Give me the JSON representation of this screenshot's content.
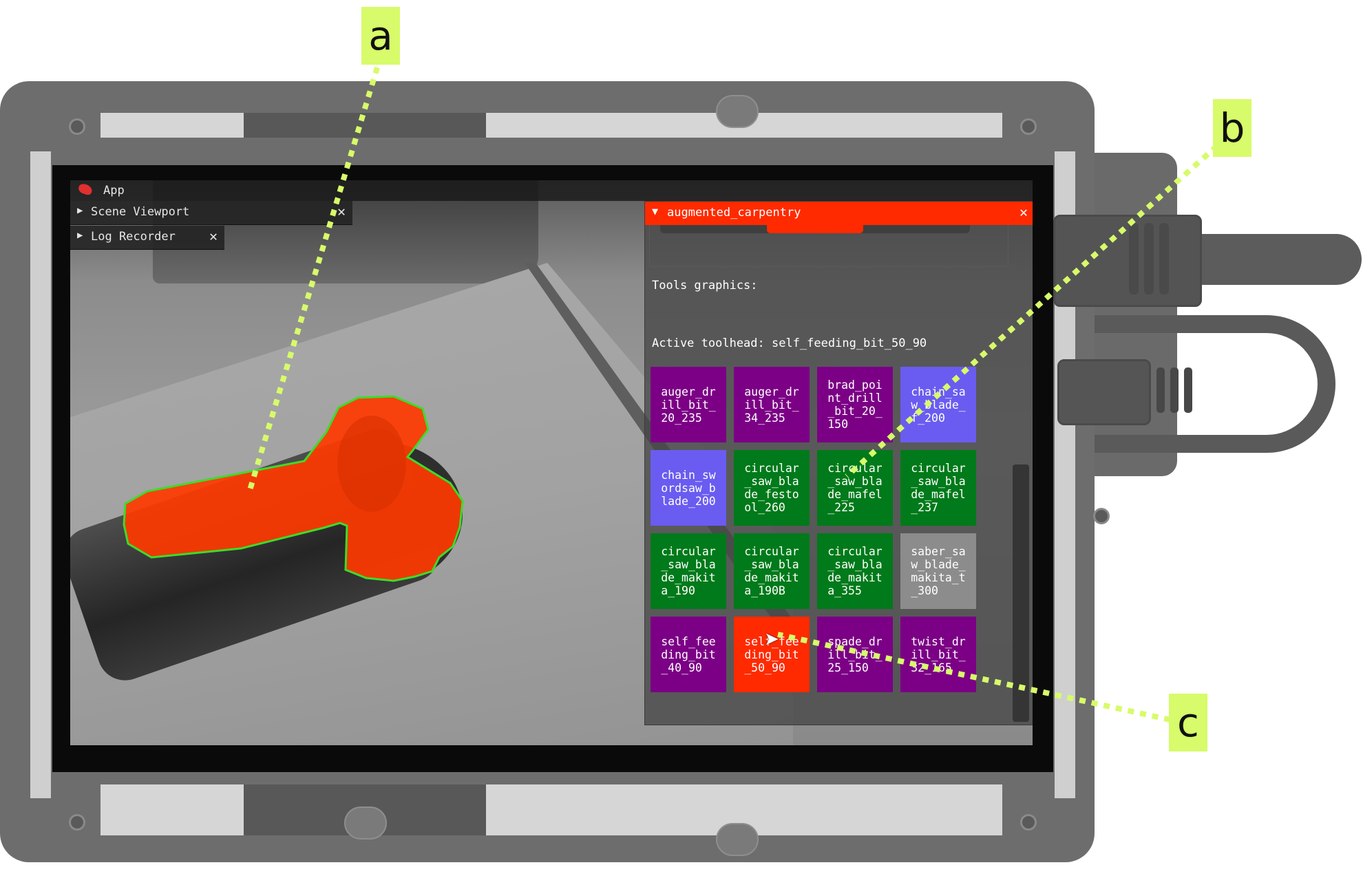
{
  "app": {
    "title": "App"
  },
  "windows": {
    "scene_viewport": {
      "title": "Scene Viewport",
      "expand_icon": "triangle-right",
      "close_label": "✕"
    },
    "log_recorder": {
      "title": "Log Recorder",
      "expand_icon": "triangle-right",
      "close_label": "✕"
    },
    "augmented_carpentry": {
      "title": "augmented_carpentry",
      "collapse_icon": "triangle-down",
      "close_label": "✕",
      "tools_graphics_label": "Tools graphics:",
      "active_toolhead_label": "Active toolhead: self_feeding_bit_50_90",
      "tools": [
        {
          "label": "auger_dr\nill_bit_\n20_235",
          "color": "#7b0085"
        },
        {
          "label": "auger_dr\nill_bit_\n34_235",
          "color": "#7b0085"
        },
        {
          "label": "brad_poi\nnt_drill\n_bit_20_\n150",
          "color": "#7b0085"
        },
        {
          "label": "chain_sa\nw_blade_\nf_200",
          "color": "#6a5cf0"
        },
        {
          "label": "chain_sw\nordsaw_b\nlade_200",
          "color": "#6a5cf0"
        },
        {
          "label": "circular\n_saw_bla\nde_festo\nol_260",
          "color": "#007a1a"
        },
        {
          "label": "circular\n_saw_bla\nde_mafel\n_225",
          "color": "#007a1a"
        },
        {
          "label": "circular\n_saw_bla\nde_mafel\n_237",
          "color": "#007a1a"
        },
        {
          "label": "circular\n_saw_bla\nde_makit\na_190",
          "color": "#007a1a"
        },
        {
          "label": "circular\n_saw_bla\nde_makit\na_190B",
          "color": "#007a1a"
        },
        {
          "label": "circular\n_saw_bla\nde_makit\na_355",
          "color": "#007a1a"
        },
        {
          "label": "saber_sa\nw_blade_\nmakita_t\n_300",
          "color": "#8c8c8c"
        },
        {
          "label": "self_fee\nding_bit\n_40_90",
          "color": "#7b0085"
        },
        {
          "label": "self_fee\nding_bit\n_50_90",
          "color": "#ff2a00"
        },
        {
          "label": "spade_dr\nill_bit_\n25_150",
          "color": "#7b0085"
        },
        {
          "label": "twist_dr\nill_bit_\n32_165",
          "color": "#7b0085"
        }
      ]
    }
  },
  "annotations": {
    "a": "a",
    "b": "b",
    "c": "c"
  },
  "colors": {
    "accent": "#ff2a00",
    "annotation": "#d7fb6a",
    "overlay_outline": "#3ddc2a"
  },
  "cursor_icon": "mouse-pointer"
}
